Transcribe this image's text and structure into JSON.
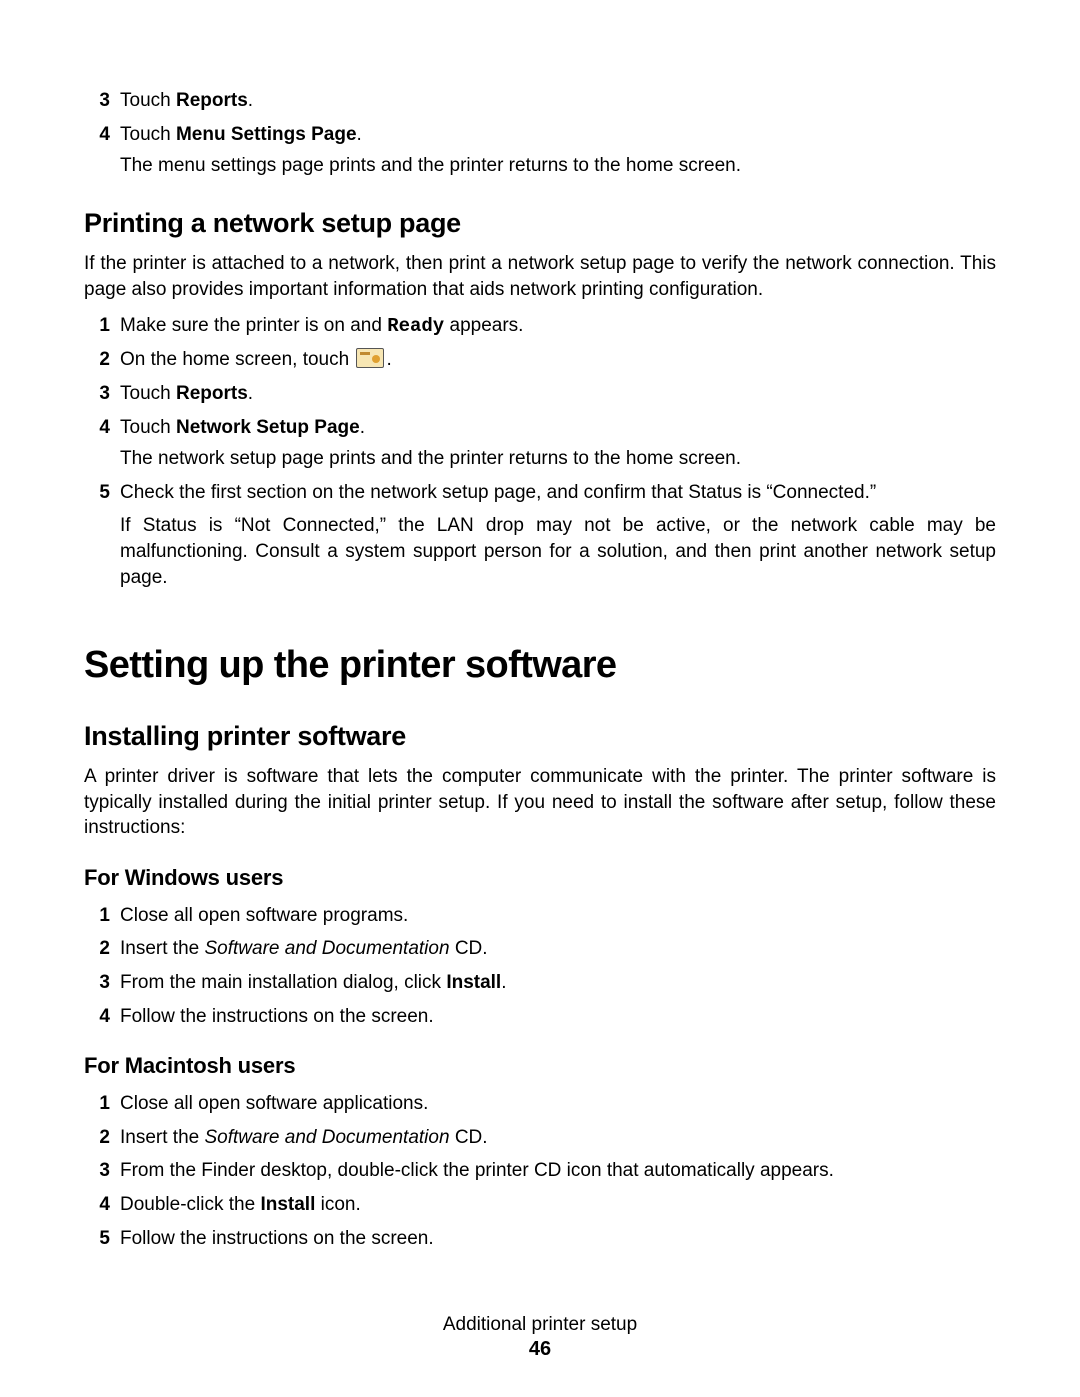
{
  "top_list": {
    "item3": {
      "num": "3",
      "pre": "Touch ",
      "bold": "Reports",
      "post": "."
    },
    "item4": {
      "num": "4",
      "pre": "Touch ",
      "bold": "Menu Settings Page",
      "post": ".",
      "sub": "The menu settings page prints and the printer returns to the home screen."
    }
  },
  "section1": {
    "title": "Printing a network setup page",
    "intro": "If the printer is attached to a network, then print a network setup page to verify the network connection. This page also provides important information that aids network printing configuration.",
    "items": {
      "i1": {
        "num": "1",
        "pre": "Make sure the printer is on and ",
        "mono": "Ready",
        "post": " appears."
      },
      "i2": {
        "num": "2",
        "pre": "On the home screen, touch ",
        "post": "."
      },
      "i3": {
        "num": "3",
        "pre": "Touch ",
        "bold": "Reports",
        "post": "."
      },
      "i4": {
        "num": "4",
        "pre": "Touch ",
        "bold": "Network Setup Page",
        "post": ".",
        "sub": "The network setup page prints and the printer returns to the home screen."
      },
      "i5": {
        "num": "5",
        "text": "Check the first section on the network setup page, and confirm that Status is “Connected.”",
        "sub": "If Status is “Not Connected,” the LAN drop may not be active, or the network cable may be malfunctioning. Consult a system support person for a solution, and then print another network setup page."
      }
    }
  },
  "section2": {
    "title": "Setting up the printer software",
    "sub1": {
      "title": "Installing printer software",
      "intro": "A printer driver is software that lets the computer communicate with the printer. The printer software is typically installed during the initial printer setup. If you need to install the software after setup, follow these instructions:",
      "win": {
        "title": "For Windows users",
        "i1": {
          "num": "1",
          "text": "Close all open software programs."
        },
        "i2": {
          "num": "2",
          "pre": "Insert the ",
          "italic": "Software and Documentation",
          "post": " CD."
        },
        "i3": {
          "num": "3",
          "pre": "From the main installation dialog, click ",
          "bold": "Install",
          "post": "."
        },
        "i4": {
          "num": "4",
          "text": "Follow the instructions on the screen."
        }
      },
      "mac": {
        "title": "For Macintosh users",
        "i1": {
          "num": "1",
          "text": "Close all open software applications."
        },
        "i2": {
          "num": "2",
          "pre": "Insert the ",
          "italic": "Software and Documentation",
          "post": " CD."
        },
        "i3": {
          "num": "3",
          "text": "From the Finder desktop, double-click the printer CD icon that automatically appears."
        },
        "i4": {
          "num": "4",
          "pre": "Double-click the ",
          "bold": "Install",
          "post": " icon."
        },
        "i5": {
          "num": "5",
          "text": "Follow the instructions on the screen."
        }
      }
    }
  },
  "footer": {
    "title": "Additional printer setup",
    "page": "46"
  }
}
